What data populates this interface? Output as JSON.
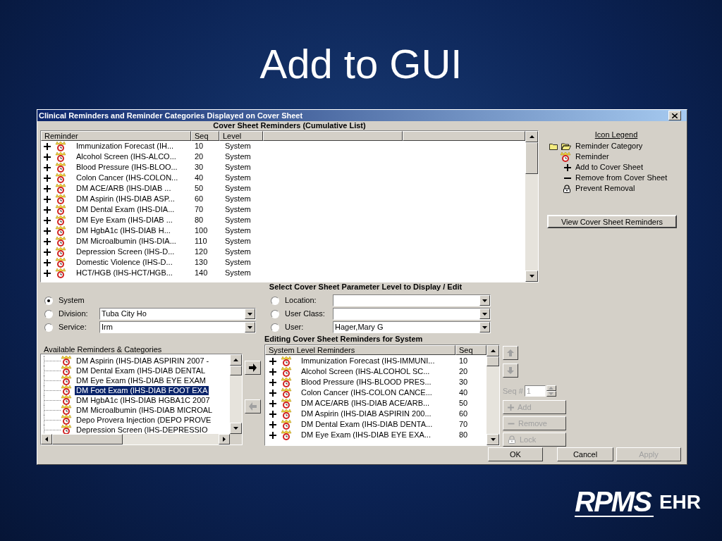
{
  "slide": {
    "title": "Add to GUI"
  },
  "window": {
    "title": "Clinical Reminders and Reminder Categories Displayed on Cover Sheet"
  },
  "cover_sheet": {
    "heading": "Cover Sheet Reminders (Cumulative List)",
    "columns": [
      "Reminder",
      "Seq",
      "Level"
    ],
    "rows": [
      {
        "reminder": "Immunization Forecast (IH...",
        "seq": "10",
        "level": "System"
      },
      {
        "reminder": "Alcohol Screen (IHS-ALCO...",
        "seq": "20",
        "level": "System"
      },
      {
        "reminder": "Blood Pressure (IHS-BLOO...",
        "seq": "30",
        "level": "System"
      },
      {
        "reminder": "Colon Cancer (IHS-COLON...",
        "seq": "40",
        "level": "System"
      },
      {
        "reminder": "DM ACE/ARB (IHS-DIAB ...",
        "seq": "50",
        "level": "System"
      },
      {
        "reminder": "DM Aspirin (IHS-DIAB ASP...",
        "seq": "60",
        "level": "System"
      },
      {
        "reminder": "DM Dental Exam (IHS-DIA...",
        "seq": "70",
        "level": "System"
      },
      {
        "reminder": "DM Eye Exam (IHS-DIAB ...",
        "seq": "80",
        "level": "System"
      },
      {
        "reminder": "DM HgbA1c (IHS-DIAB H...",
        "seq": "100",
        "level": "System"
      },
      {
        "reminder": "DM Microalbumin (IHS-DIA...",
        "seq": "110",
        "level": "System"
      },
      {
        "reminder": "Depression Screen (IHS-D...",
        "seq": "120",
        "level": "System"
      },
      {
        "reminder": "Domestic Violence (IHS-D...",
        "seq": "130",
        "level": "System"
      },
      {
        "reminder": "HCT/HGB (IHS-HCT/HGB...",
        "seq": "140",
        "level": "System"
      }
    ]
  },
  "legend": {
    "title": "Icon Legend",
    "items": [
      {
        "kind": "category",
        "label": "Reminder Category"
      },
      {
        "kind": "reminder",
        "label": "Reminder"
      },
      {
        "kind": "add",
        "label": "Add to Cover Sheet"
      },
      {
        "kind": "remove",
        "label": "Remove from Cover Sheet"
      },
      {
        "kind": "lock",
        "label": "Prevent Removal"
      }
    ],
    "button": "View Cover Sheet Reminders"
  },
  "parameter_level": {
    "heading": "Select Cover Sheet Parameter Level to Display / Edit",
    "options": [
      {
        "kind": "radio",
        "label": "System",
        "selected": true
      },
      {
        "kind": "combo",
        "label": "Division:",
        "selected": false,
        "value": "Tuba City Ho"
      },
      {
        "kind": "combo",
        "label": "Service:",
        "selected": false,
        "value": "Irm"
      },
      {
        "kind": "combo",
        "label": "Location:",
        "selected": false
      },
      {
        "kind": "combo",
        "label": "User Class:",
        "selected": false
      },
      {
        "kind": "combo",
        "label": "User:",
        "selected": false,
        "value": "Hager,Mary G"
      }
    ]
  },
  "available": {
    "label": "Available Reminders & Categories",
    "items": [
      {
        "text": "DM Aspirin (IHS-DIAB ASPIRIN 2007 -",
        "selected": false
      },
      {
        "text": "DM Dental Exam (IHS-DIAB DENTAL",
        "selected": false
      },
      {
        "text": "DM Eye Exam (IHS-DIAB EYE EXAM",
        "selected": false
      },
      {
        "text": "DM Foot Exam (IHS-DIAB FOOT EXA",
        "selected": true
      },
      {
        "text": "DM HgbA1c (IHS-DIAB HGBA1C 2007",
        "selected": false
      },
      {
        "text": "DM Microalbumin (IHS-DIAB MICROAL",
        "selected": false
      },
      {
        "text": "Depo Provera Injection (DEPO PROVE",
        "selected": false
      },
      {
        "text": "Depression Screen (IHS-DEPRESSIO",
        "selected": false
      }
    ]
  },
  "transfer_buttons": [
    {
      "kind": "right",
      "disabled": false
    },
    {
      "kind": "left",
      "disabled": true
    }
  ],
  "editing": {
    "heading": "Editing Cover Sheet Reminders for System",
    "columns": [
      "System Level Reminders",
      "Seq"
    ],
    "rows": [
      {
        "name": "Immunization Forecast (IHS-IMMUNI...",
        "seq": "10"
      },
      {
        "name": "Alcohol Screen (IHS-ALCOHOL SC...",
        "seq": "20"
      },
      {
        "name": "Blood Pressure (IHS-BLOOD PRES...",
        "seq": "30"
      },
      {
        "name": "Colon Cancer (IHS-COLON CANCE...",
        "seq": "40"
      },
      {
        "name": "DM ACE/ARB (IHS-DIAB ACE/ARB...",
        "seq": "50"
      },
      {
        "name": "DM Aspirin (IHS-DIAB ASPIRIN 200...",
        "seq": "60"
      },
      {
        "name": "DM Dental Exam (IHS-DIAB DENTA...",
        "seq": "70"
      },
      {
        "name": "DM Eye Exam (IHS-DIAB EYE EXA...",
        "seq": "80"
      }
    ]
  },
  "edit_controls": {
    "order_buttons": [
      {
        "kind": "up",
        "disabled": true
      },
      {
        "kind": "down",
        "disabled": true
      }
    ],
    "seq_label": "Seq #",
    "seq_value": "1",
    "seq_disabled": true,
    "buttons": [
      {
        "kind": "add",
        "label": "Add",
        "disabled": true
      },
      {
        "kind": "remove",
        "label": "Remove",
        "disabled": true
      },
      {
        "kind": "lock",
        "label": "Lock",
        "disabled": true
      }
    ]
  },
  "dialog_buttons": [
    {
      "label": "OK",
      "disabled": false
    },
    {
      "label": "Cancel",
      "disabled": false
    },
    {
      "label": "Apply",
      "disabled": true
    }
  ],
  "logo": {
    "name": "RPMS",
    "suffix": "EHR"
  }
}
